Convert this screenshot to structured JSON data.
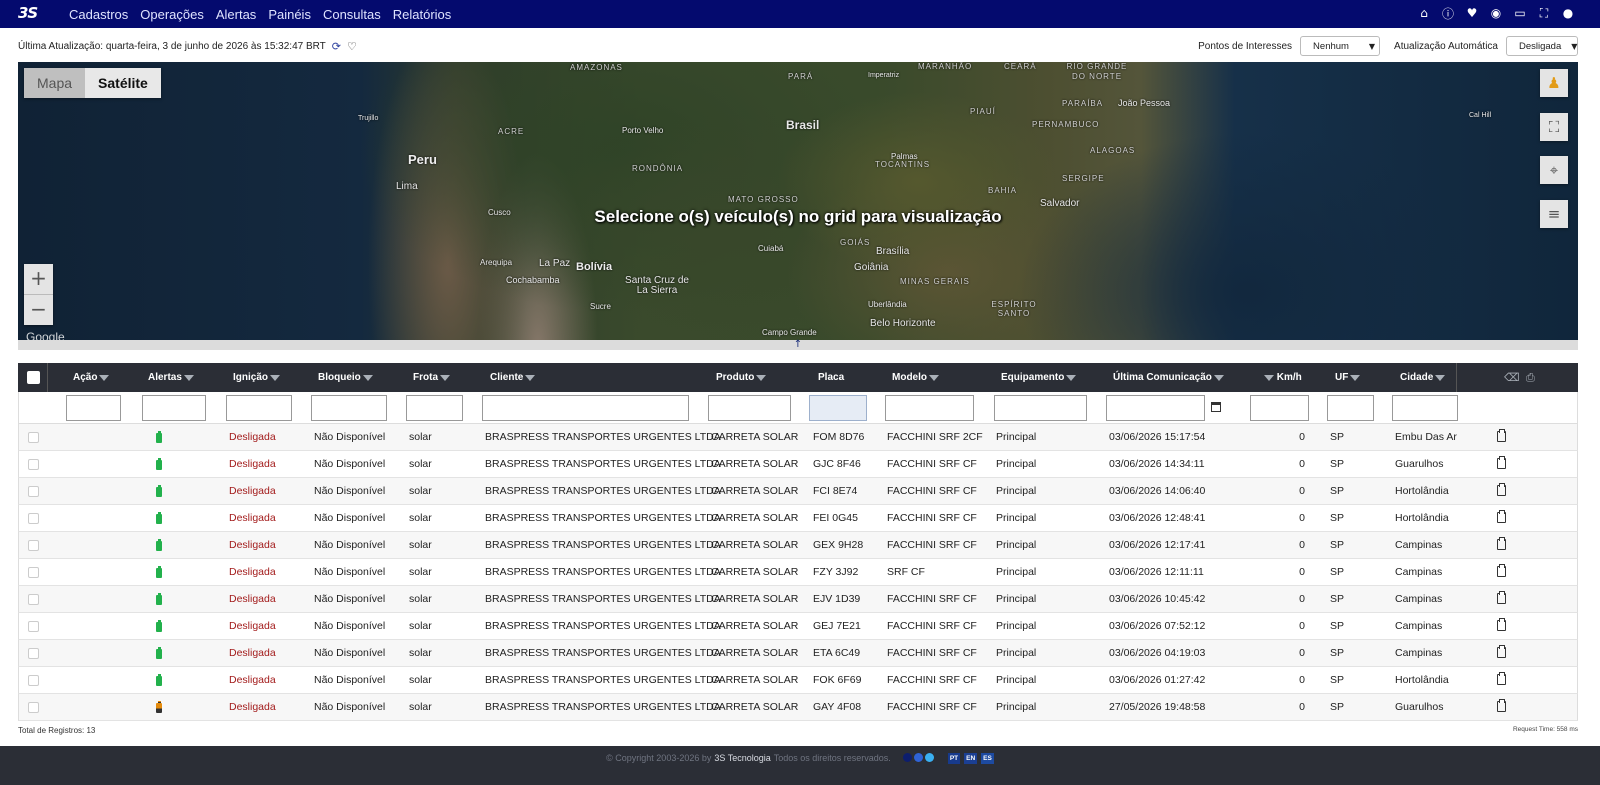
{
  "nav": {
    "logo": "3S",
    "menu": [
      "Cadastros",
      "Operações",
      "Alertas",
      "Painéis",
      "Consultas",
      "Relatórios"
    ],
    "icons": [
      "home-icon",
      "info-icon",
      "heart-icon",
      "chat-icon",
      "inbox-icon",
      "fullscreen-icon",
      "user-icon"
    ]
  },
  "update": {
    "text": "Última Atualização: quarta-feira, 3 de junho de 2026 às 15:32:47 BRT"
  },
  "controls": {
    "poi_label": "Pontos de Interesses",
    "poi_value": "Nenhum",
    "auto_label": "Atualização Automática",
    "auto_value": "Desligada"
  },
  "map": {
    "type_map": "Mapa",
    "type_satellite": "Satélite",
    "message": "Selecione o(s) veículo(s) no grid para visualização",
    "zoom_in": "+",
    "zoom_out": "−",
    "attribution": "Google",
    "labels": {
      "brasil": "Brasil",
      "peru": "Peru",
      "bolivia": "Bolívia",
      "lima": "Lima",
      "cusco": "Cusco",
      "arequipa": "Arequipa",
      "lapaz": "La Paz",
      "cochabamba": "Cochabamba",
      "santacruz": "Santa Cruz de La Sierra",
      "sucre": "Sucre",
      "trujillo": "Trujillo",
      "portovelho": "Porto Velho",
      "amazonas": "AMAZONAS",
      "para": "PARÁ",
      "maranhao": "MARANHÃO",
      "ceara": "CEARÁ",
      "rgn": "RIO GRANDE DO NORTE",
      "piaui": "PIAUÍ",
      "paraiba": "PARAÍBA",
      "joaopessoa": "João Pessoa",
      "pernambuco": "PERNAMBUCO",
      "alagoas": "ALAGOAS",
      "sergipe": "SERGIPE",
      "bahia": "BAHIA",
      "salvador": "Salvador",
      "tocantins": "TOCANTINS",
      "palmas": "Palmas",
      "acre": "ACRE",
      "rondonia": "RONDÔNIA",
      "matogrosso": "MATO GROSSO",
      "goias": "GOIÁS",
      "brasilia": "Brasília",
      "goiania": "Goiânia",
      "cuiaba": "Cuiabá",
      "minas": "MINAS GERAIS",
      "uberlandia": "Uberlândia",
      "bh": "Belo Horizonte",
      "es": "ESPÍRITO SANTO",
      "campogrande": "Campo Grande",
      "imperatriz": "Imperatriz",
      "calhill": "Cal Hill"
    }
  },
  "grid": {
    "headers": [
      "Ação",
      "Alertas",
      "Ignição",
      "Bloqueio",
      "Frota",
      "Cliente",
      "Produto",
      "Placa",
      "Modelo",
      "Equipamento",
      "Última Comunicação",
      "Km/h",
      "UF",
      "Cidade"
    ],
    "rows": [
      {
        "alert": "green",
        "ignicao": "Desligada",
        "bloqueio": "Não Disponível",
        "frota": "solar",
        "cliente": "BRASPRESS TRANSPORTES URGENTES LTDA",
        "produto": "CARRETA SOLAR",
        "placa": "FOM 8D76",
        "modelo": "FACCHINI SRF 2CF",
        "equip": "Principal",
        "ultima": "03/06/2026 15:17:54",
        "kmh": "0",
        "uf": "SP",
        "cidade": "Embu Das Artes"
      },
      {
        "alert": "green",
        "ignicao": "Desligada",
        "bloqueio": "Não Disponível",
        "frota": "solar",
        "cliente": "BRASPRESS TRANSPORTES URGENTES LTDA",
        "produto": "CARRETA SOLAR",
        "placa": "GJC 8F46",
        "modelo": "FACCHINI SRF CF",
        "equip": "Principal",
        "ultima": "03/06/2026 14:34:11",
        "kmh": "0",
        "uf": "SP",
        "cidade": "Guarulhos"
      },
      {
        "alert": "green",
        "ignicao": "Desligada",
        "bloqueio": "Não Disponível",
        "frota": "solar",
        "cliente": "BRASPRESS TRANSPORTES URGENTES LTDA",
        "produto": "CARRETA SOLAR",
        "placa": "FCI 8E74",
        "modelo": "FACCHINI SRF CF",
        "equip": "Principal",
        "ultima": "03/06/2026 14:06:40",
        "kmh": "0",
        "uf": "SP",
        "cidade": "Hortolândia"
      },
      {
        "alert": "green",
        "ignicao": "Desligada",
        "bloqueio": "Não Disponível",
        "frota": "solar",
        "cliente": "BRASPRESS TRANSPORTES URGENTES LTDA",
        "produto": "CARRETA SOLAR",
        "placa": "FEI 0G45",
        "modelo": "FACCHINI SRF CF",
        "equip": "Principal",
        "ultima": "03/06/2026 12:48:41",
        "kmh": "0",
        "uf": "SP",
        "cidade": "Hortolândia"
      },
      {
        "alert": "green",
        "ignicao": "Desligada",
        "bloqueio": "Não Disponível",
        "frota": "solar",
        "cliente": "BRASPRESS TRANSPORTES URGENTES LTDA",
        "produto": "CARRETA SOLAR",
        "placa": "GEX 9H28",
        "modelo": "FACCHINI SRF CF",
        "equip": "Principal",
        "ultima": "03/06/2026 12:17:41",
        "kmh": "0",
        "uf": "SP",
        "cidade": "Campinas"
      },
      {
        "alert": "green",
        "ignicao": "Desligada",
        "bloqueio": "Não Disponível",
        "frota": "solar",
        "cliente": "BRASPRESS TRANSPORTES URGENTES LTDA",
        "produto": "CARRETA SOLAR",
        "placa": "FZY 3J92",
        "modelo": "SRF CF",
        "equip": "Principal",
        "ultima": "03/06/2026 12:11:11",
        "kmh": "0",
        "uf": "SP",
        "cidade": "Campinas"
      },
      {
        "alert": "green",
        "ignicao": "Desligada",
        "bloqueio": "Não Disponível",
        "frota": "solar",
        "cliente": "BRASPRESS TRANSPORTES URGENTES LTDA",
        "produto": "CARRETA SOLAR",
        "placa": "EJV 1D39",
        "modelo": "FACCHINI SRF CF",
        "equip": "Principal",
        "ultima": "03/06/2026 10:45:42",
        "kmh": "0",
        "uf": "SP",
        "cidade": "Campinas"
      },
      {
        "alert": "green",
        "ignicao": "Desligada",
        "bloqueio": "Não Disponível",
        "frota": "solar",
        "cliente": "BRASPRESS TRANSPORTES URGENTES LTDA",
        "produto": "CARRETA SOLAR",
        "placa": "GEJ 7E21",
        "modelo": "FACCHINI SRF CF",
        "equip": "Principal",
        "ultima": "03/06/2026 07:52:12",
        "kmh": "0",
        "uf": "SP",
        "cidade": "Campinas"
      },
      {
        "alert": "green",
        "ignicao": "Desligada",
        "bloqueio": "Não Disponível",
        "frota": "solar",
        "cliente": "BRASPRESS TRANSPORTES URGENTES LTDA",
        "produto": "CARRETA SOLAR",
        "placa": "ETA 6C49",
        "modelo": "FACCHINI SRF CF",
        "equip": "Principal",
        "ultima": "03/06/2026 04:19:03",
        "kmh": "0",
        "uf": "SP",
        "cidade": "Campinas"
      },
      {
        "alert": "green",
        "ignicao": "Desligada",
        "bloqueio": "Não Disponível",
        "frota": "solar",
        "cliente": "BRASPRESS TRANSPORTES URGENTES LTDA",
        "produto": "CARRETA SOLAR",
        "placa": "FOK 6F69",
        "modelo": "FACCHINI SRF CF",
        "equip": "Principal",
        "ultima": "03/06/2026 01:27:42",
        "kmh": "0",
        "uf": "SP",
        "cidade": "Hortolândia"
      },
      {
        "alert": "orange",
        "ignicao": "Desligada",
        "bloqueio": "Não Disponível",
        "frota": "solar",
        "cliente": "BRASPRESS TRANSPORTES URGENTES LTDA",
        "produto": "CARRETA SOLAR",
        "placa": "GAY 4F08",
        "modelo": "FACCHINI SRF CF",
        "equip": "Principal",
        "ultima": "27/05/2026 19:48:58",
        "kmh": "0",
        "uf": "SP",
        "cidade": "Guarulhos"
      }
    ],
    "total": "Total de Registros: 13",
    "request_time": "Request Time: 558 ms"
  },
  "footer": {
    "copyright": "© Copyright 2003-2026 by",
    "brand": "3S Tecnologia",
    "rights": "Todos os direitos reservados.",
    "langs": [
      "PT",
      "EN",
      "ES"
    ]
  },
  "colors": {
    "nav": "#040a6e",
    "grid_header": "#2b2e36",
    "ignition_off": "#a31c1c",
    "battery_ok": "#22b14c",
    "battery_low": "#e58b0c"
  }
}
